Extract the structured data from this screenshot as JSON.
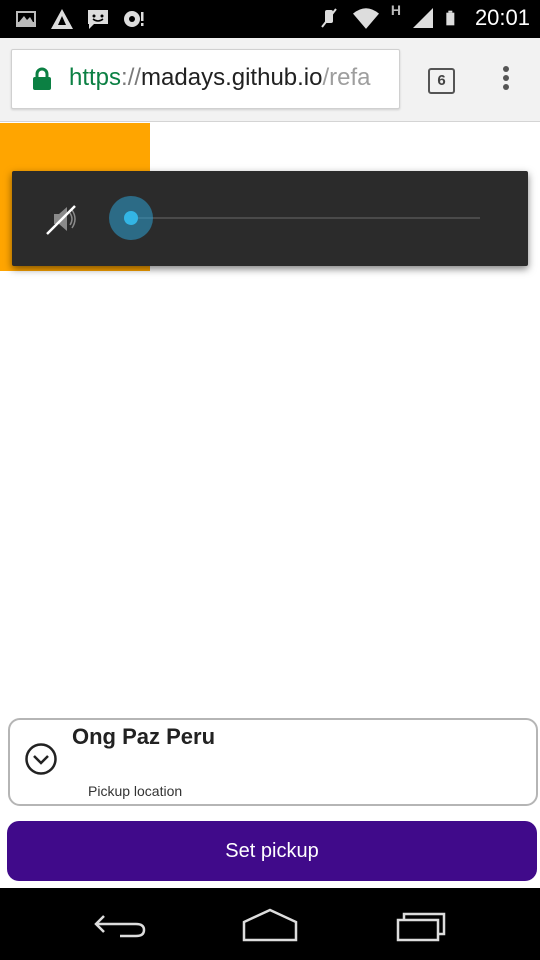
{
  "status_bar": {
    "time": "20:01",
    "network_label": "H",
    "icons": [
      "gallery-icon",
      "warning-icon",
      "chat-icon",
      "sync-icon",
      "mute-icon",
      "wifi-icon",
      "signal-icon",
      "battery-icon"
    ]
  },
  "browser": {
    "url_scheme": "https",
    "url_separator": "://",
    "url_host": "madays.github.io",
    "url_path": "/refa",
    "tab_count": "6"
  },
  "volume_popup": {
    "level": 0,
    "muted": true
  },
  "location_card": {
    "name": "Ong Paz Peru",
    "subtitle": "Pickup location"
  },
  "actions": {
    "set_pickup_label": "Set pickup"
  },
  "colors": {
    "accent_orange": "#ffa500",
    "button_purple": "#400a8a",
    "slider_blue": "#33b5e5",
    "url_green": "#0b8043"
  }
}
